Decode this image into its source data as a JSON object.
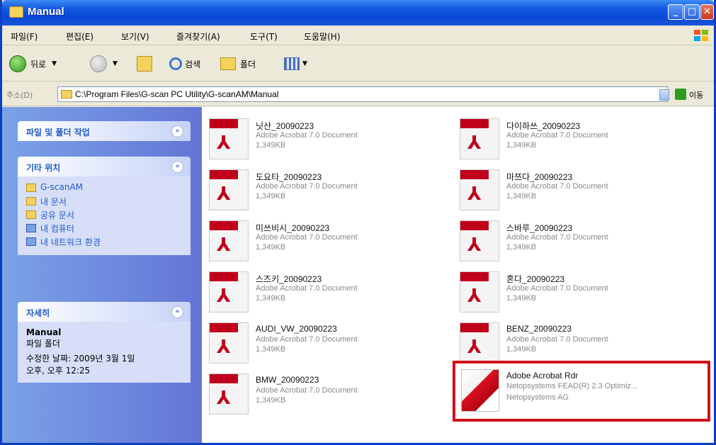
{
  "window": {
    "title": "Manual"
  },
  "menu": [
    "파일(F)",
    "편집(E)",
    "보기(V)",
    "즐겨찾기(A)",
    "도구(T)",
    "도움말(H)"
  ],
  "toolbar": {
    "back": "뒤로",
    "search": "검색",
    "folders": "폴더"
  },
  "address": {
    "label": "주소(D)",
    "path": "C:\\Program Files\\G-scan PC Utility\\G-scanAM\\Manual",
    "go": "이동"
  },
  "left_pane": {
    "tasks_title": "파일 및 폴더 작업",
    "places_title": "기타 위치",
    "places": [
      "G-scanAM",
      "내 문서",
      "공유 문서",
      "내 컴퓨터",
      "내 네트워크 환경"
    ],
    "details_title": "자세히",
    "details": {
      "name": "Manual",
      "type": "파일 폴더",
      "modified": "수정한 날짜: 2009년 3월 1일",
      "time": "오후, 오후 12:25"
    }
  },
  "files": [
    {
      "name": "닛산_20090223",
      "type": "Adobe Acrobat 7.0 Document",
      "size": "1,349KB"
    },
    {
      "name": "다이하쓰_20090223",
      "type": "Adobe Acrobat 7.0 Document",
      "size": "1,349KB"
    },
    {
      "name": "도요타_20090223",
      "type": "Adobe Acrobat 7.0 Document",
      "size": "1,349KB"
    },
    {
      "name": "마쯔다_20090223",
      "type": "Adobe Acrobat 7.0 Document",
      "size": "1,349KB"
    },
    {
      "name": "미쓰비시_20090223",
      "type": "Adobe Acrobat 7.0 Document",
      "size": "1,349KB"
    },
    {
      "name": "스바루_20090223",
      "type": "Adobe Acrobat 7.0 Document",
      "size": "1,349KB"
    },
    {
      "name": "스즈키_20090223",
      "type": "Adobe Acrobat 7.0 Document",
      "size": "1,349KB"
    },
    {
      "name": "혼다_20090223",
      "type": "Adobe Acrobat 7.0 Document",
      "size": "1,349KB"
    },
    {
      "name": "AUDI_VW_20090223",
      "type": "Adobe Acrobat 7.0 Document",
      "size": "1,349KB"
    },
    {
      "name": "BENZ_20090223",
      "type": "Adobe Acrobat 7.0 Document",
      "size": "1,349KB"
    },
    {
      "name": "BMW_20090223",
      "type": "Adobe Acrobat 7.0 Document",
      "size": "1,349KB"
    }
  ],
  "installer": {
    "name": "Adobe Acrobat Rdr",
    "desc": "Netopsystems FEAD(R) 2.3 Optimiz...",
    "company": "Netopsystems AG"
  }
}
